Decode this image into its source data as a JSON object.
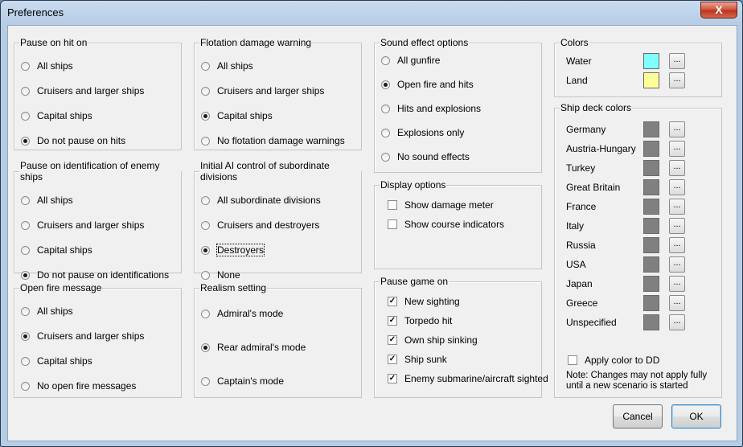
{
  "window": {
    "title": "Preferences",
    "close_label": "X"
  },
  "pause_on_hit": {
    "title": "Pause on hit on",
    "options": [
      "All ships",
      "Cruisers and larger ships",
      "Capital ships",
      "Do not pause on hits"
    ],
    "selected": 3
  },
  "pause_on_identification": {
    "title": "Pause on identification of enemy ships",
    "options": [
      "All ships",
      "Cruisers and larger ships",
      "Capital ships",
      "Do not pause on identifications"
    ],
    "selected": 3
  },
  "open_fire_message": {
    "title": "Open fire message",
    "options": [
      "All ships",
      "Cruisers and larger ships",
      "Capital ships",
      "No open fire messages"
    ],
    "selected": 1
  },
  "flotation_warning": {
    "title": "Flotation damage warning",
    "options": [
      "All ships",
      "Cruisers and larger ships",
      "Capital ships",
      "No flotation damage warnings"
    ],
    "selected": 2
  },
  "initial_ai_control": {
    "title": "Initial AI control of subordinate divisions",
    "options": [
      "All subordinate divisions",
      "Cruisers and destroyers",
      "Destroyers",
      "None"
    ],
    "selected": 2
  },
  "realism_setting": {
    "title": "Realism setting",
    "options": [
      "Admiral's mode",
      "Rear admiral's mode",
      "Captain's mode"
    ],
    "selected": 1
  },
  "sound_effects": {
    "title": "Sound effect options",
    "options": [
      "All gunfire",
      "Open fire and hits",
      "Hits and explosions",
      "Explosions only",
      "No sound effects"
    ],
    "selected": 1
  },
  "display_options": {
    "title": "Display options",
    "items": [
      {
        "label": "Show damage meter",
        "checked": false
      },
      {
        "label": "Show course indicators",
        "checked": false
      }
    ]
  },
  "pause_game_on": {
    "title": "Pause game on",
    "items": [
      {
        "label": "New sighting",
        "checked": true
      },
      {
        "label": "Torpedo hit",
        "checked": true
      },
      {
        "label": "Own ship sinking",
        "checked": true
      },
      {
        "label": "Ship sunk",
        "checked": true
      },
      {
        "label": "Enemy submarine/aircraft sighted",
        "checked": true
      }
    ]
  },
  "colors": {
    "title": "Colors",
    "button_label": "...",
    "items": [
      {
        "label": "Water",
        "color": "#80ffff"
      },
      {
        "label": "Land",
        "color": "#ffff99"
      }
    ]
  },
  "ship_deck_colors": {
    "title": "Ship deck colors",
    "button_label": "...",
    "items": [
      {
        "label": "Germany",
        "color": "#808080"
      },
      {
        "label": "Austria-Hungary",
        "color": "#808080"
      },
      {
        "label": "Turkey",
        "color": "#808080"
      },
      {
        "label": "Great Britain",
        "color": "#808080"
      },
      {
        "label": "France",
        "color": "#808080"
      },
      {
        "label": "Italy",
        "color": "#808080"
      },
      {
        "label": "Russia",
        "color": "#808080"
      },
      {
        "label": "USA",
        "color": "#808080"
      },
      {
        "label": "Japan",
        "color": "#808080"
      },
      {
        "label": "Greece",
        "color": "#808080"
      },
      {
        "label": "Unspecified",
        "color": "#808080"
      }
    ],
    "apply_to_dd": {
      "label": "Apply color to DD",
      "checked": false
    },
    "note": "Note: Changes may not apply fully until a new scenario is started"
  },
  "buttons": {
    "cancel": "Cancel",
    "ok": "OK"
  }
}
